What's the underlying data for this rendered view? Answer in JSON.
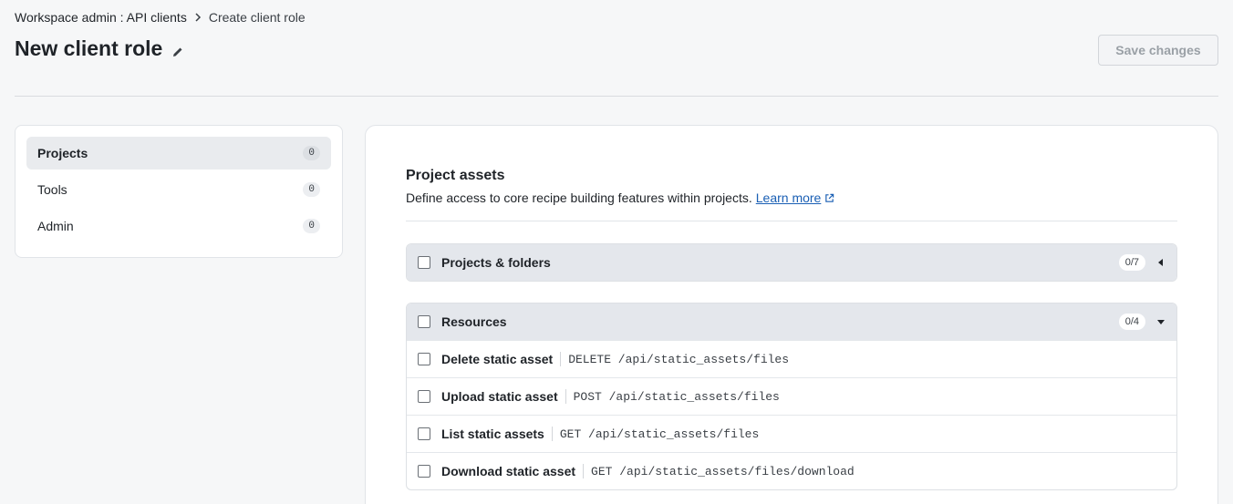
{
  "breadcrumb": {
    "parent": "Workspace admin : API clients",
    "current": "Create client role"
  },
  "page": {
    "title": "New client role",
    "save_label": "Save changes"
  },
  "sidebar": {
    "items": [
      {
        "label": "Projects",
        "count": "0",
        "active": true
      },
      {
        "label": "Tools",
        "count": "0",
        "active": false
      },
      {
        "label": "Admin",
        "count": "0",
        "active": false
      }
    ]
  },
  "main": {
    "section_title": "Project assets",
    "section_desc": "Define access to core recipe building features within projects.",
    "learn_more": "Learn more",
    "groups": [
      {
        "label": "Projects & folders",
        "count": "0/7",
        "expanded": false
      },
      {
        "label": "Resources",
        "count": "0/4",
        "expanded": true,
        "permissions": [
          {
            "name": "Delete static asset",
            "endpoint": "DELETE /api/static_assets/files"
          },
          {
            "name": "Upload static asset",
            "endpoint": "POST /api/static_assets/files"
          },
          {
            "name": "List static assets",
            "endpoint": "GET /api/static_assets/files"
          },
          {
            "name": "Download static asset",
            "endpoint": "GET /api/static_assets/files/download"
          }
        ]
      }
    ]
  },
  "icons": {
    "breadcrumb_separator": "chevron-right-icon",
    "title_edit": "pencil-icon",
    "external_link": "external-link-icon",
    "collapsed": "caret-left-icon",
    "expanded": "caret-down-icon"
  }
}
